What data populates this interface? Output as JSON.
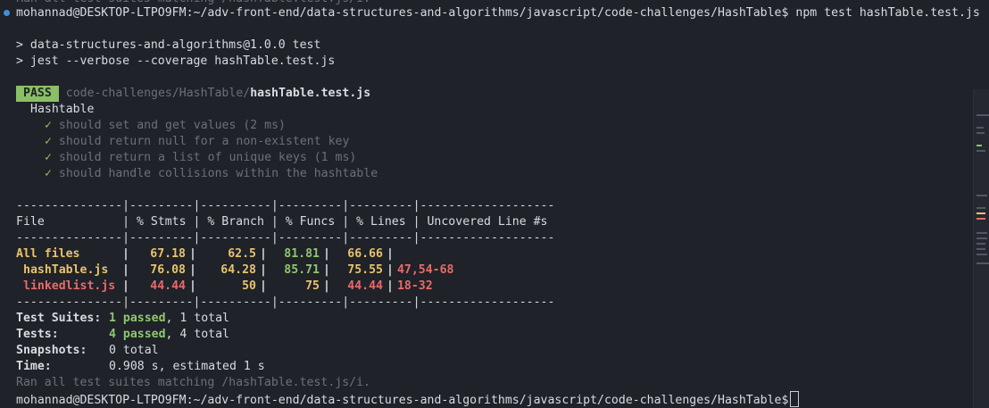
{
  "terminal": {
    "top_partial": "Ran all test suites matching /hashTable.test.js/i.",
    "prompt_user": "mohannad@DESKTOP-LTPO9FM",
    "prompt_path": ":~/adv-front-end/data-structures-and-algorithms/javascript/code-challenges/HashTable",
    "prompt_symbol": "$",
    "command": " npm test hashTable.test.js",
    "script_line1": "> data-structures-and-algorithms@1.0.0 test",
    "script_line2": "> jest --verbose --coverage hashTable.test.js",
    "pass_label": "PASS",
    "test_path_dir": "code-challenges/HashTable/",
    "test_path_file": "hashTable.test.js",
    "suite_name": "Hashtable",
    "check_mark": "✓",
    "tests": [
      {
        "name": "should set and get values",
        "time": " (2 ms)"
      },
      {
        "name": "should return null for a non-existent key",
        "time": ""
      },
      {
        "name": "should return a list of unique keys",
        "time": " (1 ms)"
      },
      {
        "name": "should handle collisions within the hashtable",
        "time": ""
      }
    ],
    "coverage": {
      "separator": "---------------|---------|----------|---------|---------|-------------------",
      "header": "File           | % Stmts | % Branch | % Funcs | % Lines | Uncovered Line #s ",
      "rows": [
        {
          "file": "All files",
          "stmts": "67.18",
          "branch": "62.5",
          "funcs": "81.81",
          "lines": "66.66",
          "uncovered": ""
        },
        {
          "file": "hashTable.js",
          "stmts": "76.08",
          "branch": "64.28",
          "funcs": "85.71",
          "lines": "75.55",
          "uncovered": "47,54-68"
        },
        {
          "file": "linkedlist.js",
          "stmts": "44.44",
          "branch": "50",
          "funcs": "75",
          "lines": "44.44",
          "uncovered": "18-32"
        }
      ]
    },
    "summary": {
      "suites_label": "Test Suites:",
      "suites_passed": "1 passed",
      "suites_total": ", 1 total",
      "tests_label": "Tests:",
      "tests_passed": "4 passed",
      "tests_total": ", 4 total",
      "snapshots_label": "Snapshots:",
      "snapshots_value": "0 total",
      "time_label": "Time:",
      "time_value": "0.908 s, estimated 1 s",
      "ran_all": "Ran all test suites matching /hashTable.test.js/i."
    }
  },
  "colors": {
    "background": "#1f2228",
    "pass_badge": "#8bbf66",
    "green": "#8fc76f",
    "yellow": "#e8c36b",
    "red": "#ea6a6a",
    "prompt_dot": "#3f8fd8"
  }
}
